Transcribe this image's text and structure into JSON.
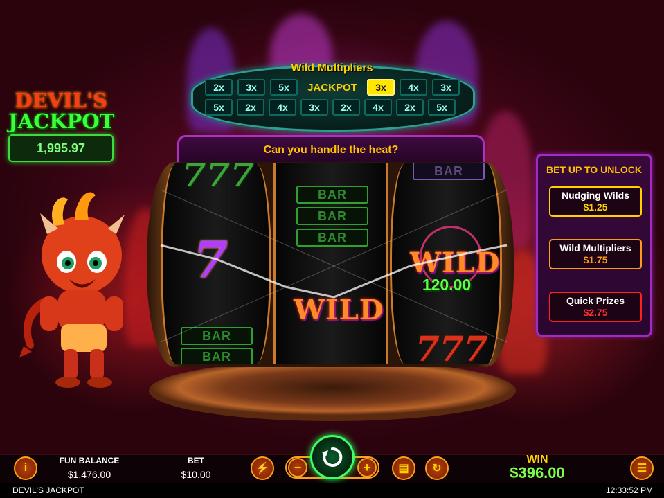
{
  "game": {
    "title": "DEVIL'S JACKPOT",
    "logo_line1": "DEVIL'S",
    "logo_line2": "JACKPOT",
    "jackpot_value": "1,995.97",
    "tagline": "Can you handle the heat?"
  },
  "multipliers": {
    "title": "Wild Multipliers",
    "row1": [
      "2x",
      "3x",
      "5x",
      "JACKPOT",
      "3x",
      "4x",
      "3x"
    ],
    "row2": [
      "5x",
      "2x",
      "4x",
      "3x",
      "2x",
      "4x",
      "2x",
      "5x"
    ],
    "active_index_row1": 4
  },
  "reels": {
    "reel1": [
      "777",
      "7",
      "BAR",
      "BAR"
    ],
    "reel2": [
      "BAR",
      "BAR",
      "BAR",
      "WILD"
    ],
    "reel3": [
      "BAR",
      "WILD",
      "777"
    ],
    "bar_label": "BAR",
    "wild_label": "WILD",
    "seven_label": "7",
    "triple_seven_label": "777",
    "win_amount": "120.00"
  },
  "unlock_panel": {
    "title": "BET UP TO UNLOCK",
    "options": [
      {
        "label": "Nudging Wilds",
        "price": "$1.25"
      },
      {
        "label": "Wild Multipliers",
        "price": "$1.75"
      },
      {
        "label": "Quick Prizes",
        "price": "$2.75"
      }
    ]
  },
  "bottom_bar": {
    "info_icon": "info-icon",
    "fun_balance_label": "FUN BALANCE",
    "fun_balance_value": "$1,476.00",
    "bet_label": "BET",
    "bet_value": "$10.00",
    "minus": "−",
    "plus": "+",
    "win_label": "WIN",
    "win_value": "$396.00"
  },
  "footer": {
    "game_name": "DEVIL'S JACKPOT",
    "time": "12:33:52 PM"
  },
  "colors": {
    "accent_gold": "#ffd200",
    "jackpot_green": "#3cff3c",
    "panel_purple": "#a22bc2",
    "spin_green": "#3cff6a"
  }
}
